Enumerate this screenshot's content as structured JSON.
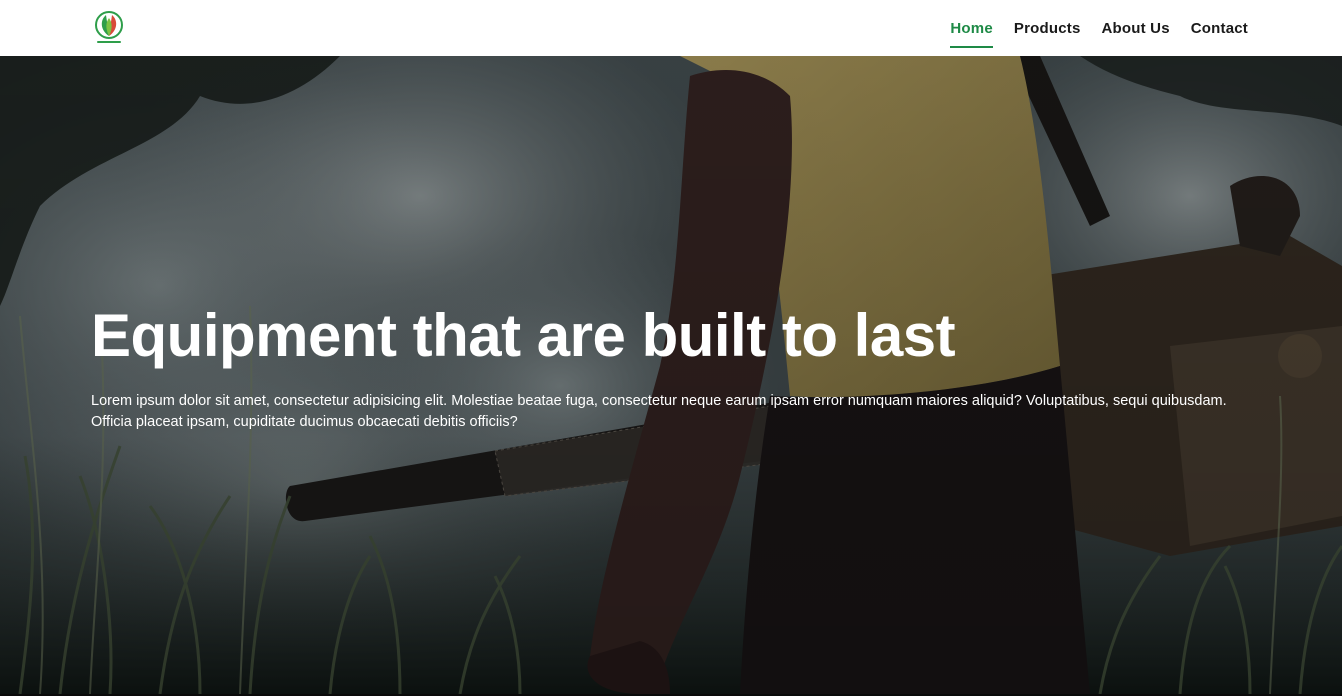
{
  "navbar": {
    "logo_icon": "leaf-logo-icon",
    "links": [
      {
        "label": "Home",
        "active": true
      },
      {
        "label": "Products",
        "active": false
      },
      {
        "label": "About Us",
        "active": false
      },
      {
        "label": "Contact",
        "active": false
      }
    ],
    "accent_color": "#1e8a46"
  },
  "hero": {
    "title": "Equipment that are built to last",
    "body": "Lorem ipsum dolor sit amet, consectetur adipisicing elit. Molestiae beatae fuga, consectetur neque earum ipsam error numquam maiores aliquid? Voluptatibus, sequi quibusdam. Officia placeat ipsam, cupiditate ducimus obcaecati debitis officiis?",
    "background_image": "worker-with-fogging-machine-photo"
  }
}
